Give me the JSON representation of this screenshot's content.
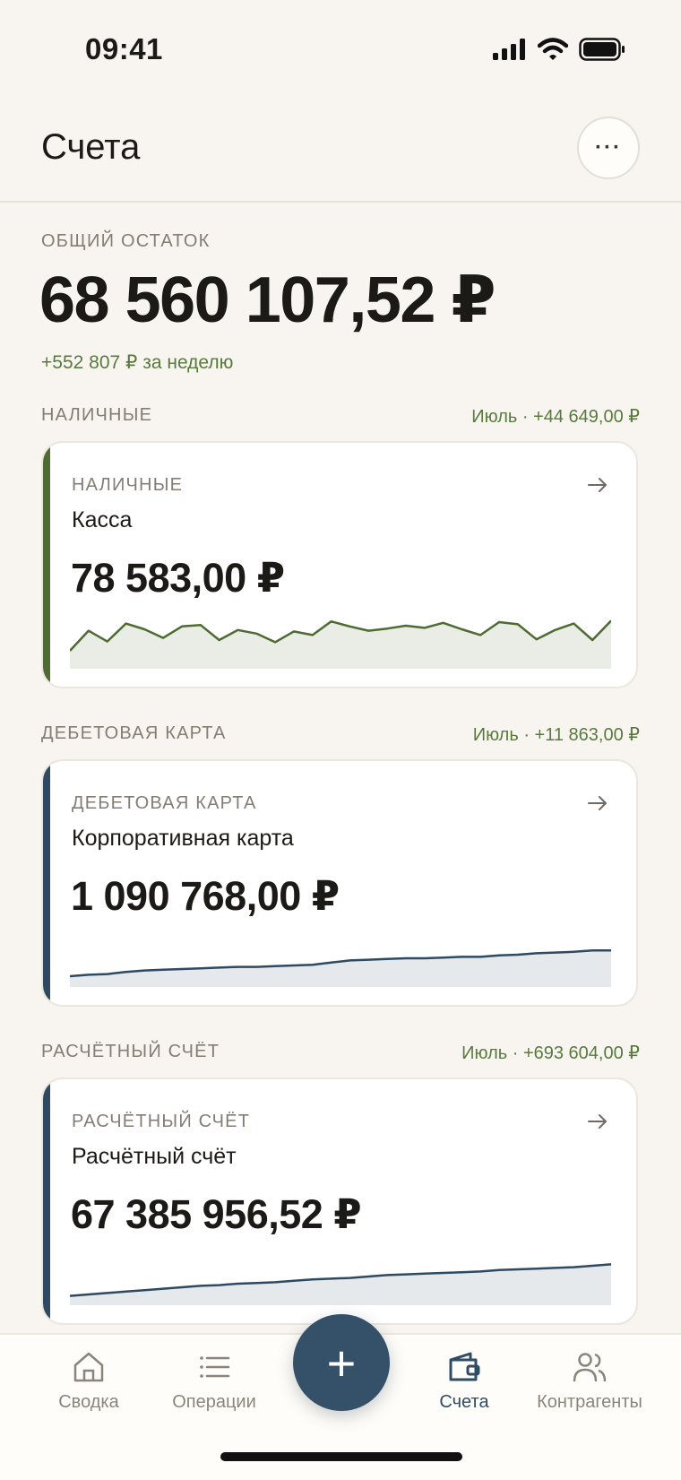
{
  "status_bar": {
    "time": "09:41"
  },
  "header": {
    "title": "Счета",
    "more_label": "···"
  },
  "summary": {
    "label": "ОБЩИЙ ОСТАТОК",
    "amount": "68 560 107,52 ₽",
    "change": "+552 807 ₽ за неделю"
  },
  "colors": {
    "cash_accent": "#4e6b32",
    "debit_accent": "#2e4a62",
    "settlement_accent": "#2e4a62",
    "positive": "#587a3c",
    "active_tab": "#2f4c66"
  },
  "sections": [
    {
      "title": "НАЛИЧНЫЕ",
      "month_change": "Июль · +44 649,00 ₽",
      "card": {
        "type": "НАЛИЧНЫЕ",
        "name": "Касса",
        "balance": "78 583,00 ₽",
        "arrow_icon": "arrow-right-icon",
        "trend": [
          20,
          48,
          33,
          58,
          50,
          38,
          54,
          56,
          35,
          49,
          44,
          32,
          47,
          42,
          61,
          54,
          48,
          51,
          55,
          52,
          59,
          50,
          42,
          60,
          57,
          36,
          49,
          58,
          35,
          62
        ]
      }
    },
    {
      "title": "ДЕБЕТОВАЯ КАРТА",
      "month_change": "Июль · +11 863,00 ₽",
      "card": {
        "type": "ДЕБЕТОВАЯ КАРТА",
        "name": "Корпоративная карта",
        "balance": "1 090 768,00 ₽",
        "arrow_icon": "arrow-right-icon",
        "trend": [
          10,
          12,
          13,
          16,
          18,
          19,
          20,
          21,
          22,
          23,
          23,
          24,
          25,
          26,
          29,
          32,
          33,
          34,
          35,
          35,
          36,
          37,
          37,
          39,
          40,
          42,
          43,
          44,
          46,
          46
        ]
      }
    },
    {
      "title": "РАСЧЁТНЫЙ СЧЁТ",
      "month_change": "Июль · +693 604,00 ₽",
      "card": {
        "type": "РАСЧЁТНЫЙ СЧЁТ",
        "name": "Расчётный счёт",
        "balance": "67 385 956,52 ₽",
        "arrow_icon": "arrow-right-icon",
        "trend": [
          8,
          10,
          12,
          14,
          16,
          18,
          20,
          22,
          23,
          25,
          26,
          27,
          29,
          31,
          32,
          33,
          35,
          37,
          38,
          39,
          40,
          41,
          42,
          44,
          45,
          46,
          47,
          48,
          50,
          52
        ]
      }
    }
  ],
  "tab_bar": {
    "tabs": [
      {
        "label": "Сводка",
        "icon": "home-icon"
      },
      {
        "label": "Операции",
        "icon": "list-icon"
      },
      {
        "label": "Счета",
        "icon": "wallet-icon",
        "active": true
      },
      {
        "label": "Контрагенты",
        "icon": "people-icon"
      }
    ],
    "fab_label": "+"
  }
}
